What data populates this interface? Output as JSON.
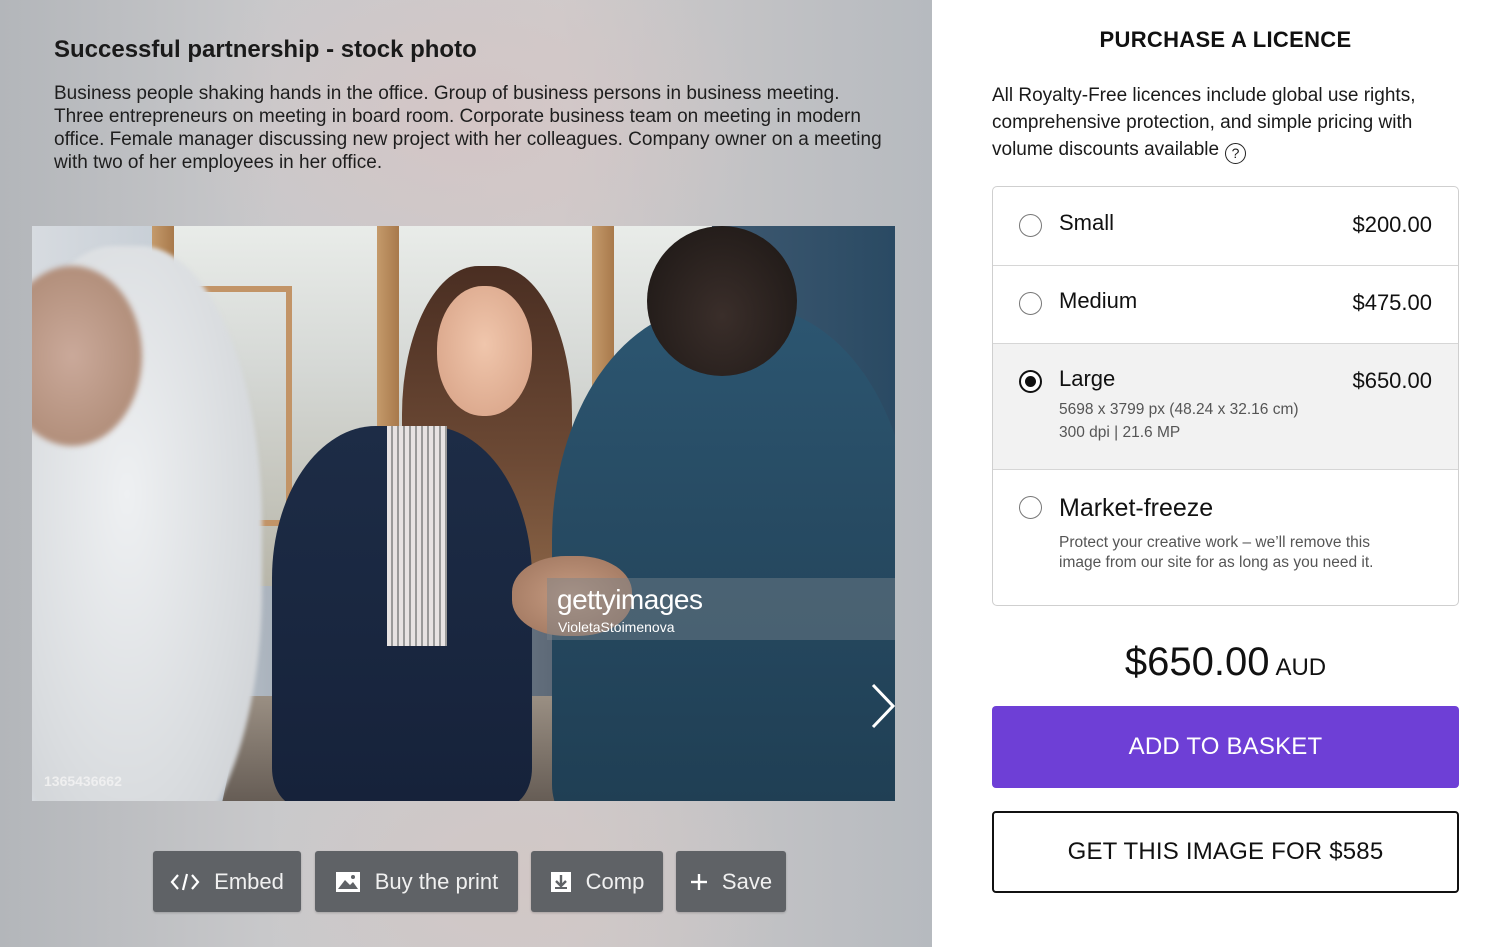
{
  "image": {
    "title": "Successful partnership - stock photo",
    "description": "Business people shaking hands in the office. Group of business persons in business meeting. Three entrepreneurs on meeting in board room. Corporate business team on meeting in modern office. Female manager discussing new project with her colleagues. Company owner on a meeting with two of her employees in her office.",
    "watermark_brand": "gettyimages",
    "watermark_author": "VioletaStoimenova",
    "id": "1365436662"
  },
  "actions": {
    "embed": "Embed",
    "buy_print": "Buy the print",
    "comp": "Comp",
    "save": "Save"
  },
  "licence": {
    "heading": "PURCHASE A LICENCE",
    "description": "All Royalty-Free licences include global use rights, comprehensive protection, and simple pricing with volume discounts available",
    "help": "?",
    "options": [
      {
        "name": "Small",
        "price": "$200.00",
        "selected": false
      },
      {
        "name": "Medium",
        "price": "$475.00",
        "selected": false
      },
      {
        "name": "Large",
        "price": "$650.00",
        "selected": true,
        "detail1": "5698 x 3799 px (48.24 x 32.16 cm)",
        "detail2": "300 dpi | 21.6 MP"
      },
      {
        "name": "Market-freeze",
        "price": "",
        "selected": false,
        "detail1": "Protect your creative work – we’ll remove this",
        "detail2": "image from our site for as long as you need it."
      }
    ],
    "total_amount": "$650.00",
    "total_currency": "AUD",
    "add_to_basket": "ADD TO BASKET",
    "get_image": "GET THIS IMAGE FOR $585"
  },
  "colors": {
    "accent": "#6e3fd6",
    "action_button": "#5f6266"
  },
  "icons": [
    "code-icon",
    "image-icon",
    "download-icon",
    "plus-icon",
    "chevron-right-icon",
    "help-icon"
  ]
}
